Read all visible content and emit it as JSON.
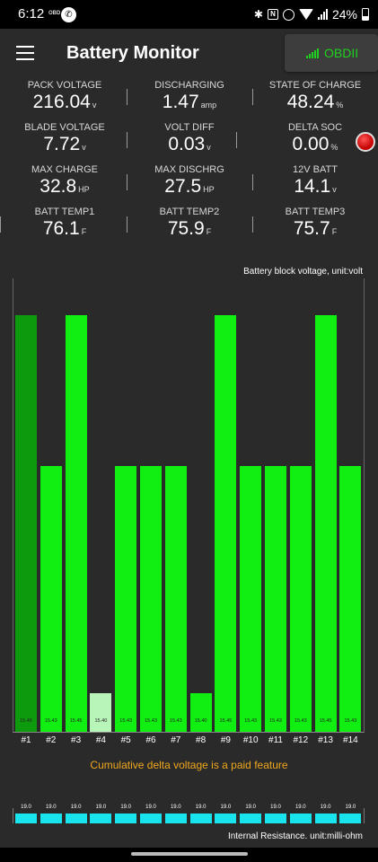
{
  "status_bar": {
    "time": "6:12",
    "obd_badge": "OBD",
    "battery_pct": "24%"
  },
  "app": {
    "title": "Battery Monitor",
    "obd_button": "OBDII"
  },
  "metrics": [
    {
      "label": "PACK VOLTAGE",
      "value": "216.04",
      "unit": "v"
    },
    {
      "label": "DISCHARGING",
      "value": "1.47",
      "unit": "amp"
    },
    {
      "label": "STATE OF CHARGE",
      "value": "48.24",
      "unit": "%"
    },
    {
      "label": "BLADE VOLTAGE",
      "value": "7.72",
      "unit": "v"
    },
    {
      "label": "VOLT DIFF",
      "value": "0.03",
      "unit": "v"
    },
    {
      "label": "DELTA SOC",
      "value": "0.00",
      "unit": "%"
    },
    {
      "label": "MAX CHARGE",
      "value": "32.8",
      "unit": "HP"
    },
    {
      "label": "MAX DISCHRG",
      "value": "27.5",
      "unit": "HP"
    },
    {
      "label": "12V BATT",
      "value": "14.1",
      "unit": "v"
    },
    {
      "label": "BATT TEMP1",
      "value": "76.1",
      "unit": "F"
    },
    {
      "label": "BATT TEMP2",
      "value": "75.9",
      "unit": "F"
    },
    {
      "label": "BATT TEMP3",
      "value": "75.7",
      "unit": "F"
    }
  ],
  "colors": {
    "bar_bright": "#11ee11",
    "bar_dark": "#0d9a0d",
    "bar_pale": "#b8f5b8",
    "accent_green": "#1fd01f",
    "paid_note": "#f0a81c",
    "ir_bar": "#19e3ec"
  },
  "chart_data": {
    "type": "bar",
    "title": "Battery block voltage, unit:volt",
    "categories": [
      "#1",
      "#2",
      "#3",
      "#4",
      "#5",
      "#6",
      "#7",
      "#8",
      "#9",
      "#10",
      "#11",
      "#12",
      "#13",
      "#14"
    ],
    "values": [
      15.45,
      15.43,
      15.45,
      15.4,
      15.43,
      15.43,
      15.43,
      15.4,
      15.45,
      15.43,
      15.43,
      15.43,
      15.45,
      15.43
    ],
    "value_labels": [
      "15.45",
      "15.43",
      "15.45",
      "15.40",
      "15.43",
      "15.43",
      "15.43",
      "15.40",
      "15.45",
      "15.43",
      "15.43",
      "15.43",
      "15.45",
      "15.43"
    ],
    "highlight": {
      "max_index": 0,
      "min_index": 3
    },
    "grid": false
  },
  "paid_note": "Cumulative delta voltage is a paid feature",
  "internal_resistance": {
    "title": "Internal Resistance. unit:milli-ohm",
    "values": [
      "19.0",
      "19.0",
      "19.0",
      "19.0",
      "19.0",
      "19.0",
      "19.0",
      "19.0",
      "19.0",
      "19.0",
      "19.0",
      "19.0",
      "19.0",
      "19.0"
    ]
  }
}
